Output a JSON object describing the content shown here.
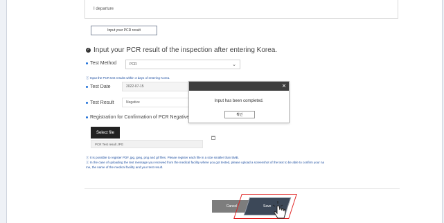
{
  "top_field": {
    "text": "I departure"
  },
  "pcr_button": {
    "label": "Input your PCR result"
  },
  "section": {
    "title": "Input your PCR result of the inspection after entering Korea."
  },
  "test_method": {
    "label": "Test Method",
    "value": "PCR"
  },
  "hint": {
    "text": "Input the PCR test results within 3 days of entering Korea."
  },
  "test_date": {
    "label": "Test Date",
    "value": "2022-07-15"
  },
  "test_result": {
    "label": "Test Result",
    "value": "Negative"
  },
  "registration": {
    "label": "Registration for Confirmation of PCR Negative"
  },
  "file": {
    "button_label": "Select file",
    "name": "PCR Test result JPG"
  },
  "notes": {
    "line1": "It is possible to register PDF, jpg, jpeg, png and gif files. Please register each file in a size smaller than 5MB.",
    "line2": "In the case of uploading the text message you received from the medical facility where you got tested, please upload a screenshot of the text to be able to confirm your na",
    "line3": "me, the name of the medical facility and your test result."
  },
  "actions": {
    "cancel_label": "Cancel",
    "save_label": "Save"
  },
  "modal": {
    "message": "Input has been completed.",
    "ok_label": "확인",
    "close_glyph": "×"
  },
  "colors": {
    "accent": "#1e6fd9",
    "highlight": "#e02020",
    "modal_header": "#3d3d3d"
  }
}
